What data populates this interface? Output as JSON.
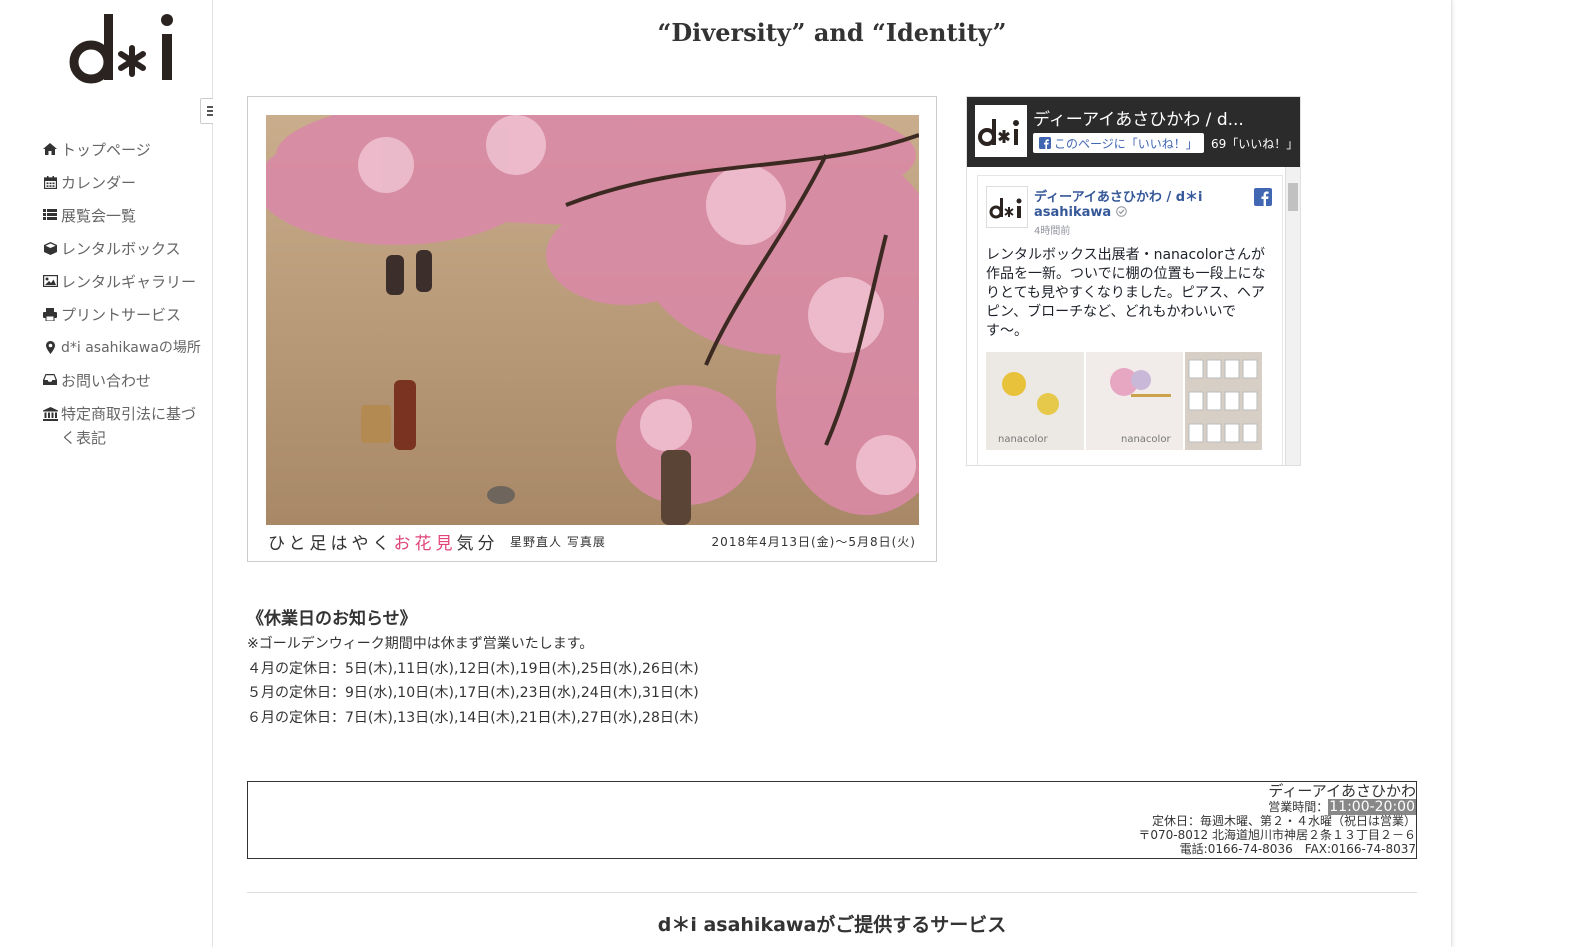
{
  "brand": {
    "logo_text": "d*i"
  },
  "nav": {
    "toggle_icon": "hamburger-icon",
    "items": [
      {
        "label": "トップページ",
        "icon": "home-icon"
      },
      {
        "label": "カレンダー",
        "icon": "calendar-icon"
      },
      {
        "label": "展覧会一覧",
        "icon": "list-icon"
      },
      {
        "label": "レンタルボックス",
        "icon": "cube-icon"
      },
      {
        "label": "レンタルギャラリー",
        "icon": "picture-icon"
      },
      {
        "label": "プリントサービス",
        "icon": "print-icon"
      },
      {
        "label": "d*i asahikawaの場所",
        "icon": "map-marker-icon"
      },
      {
        "label": "お問い合わせ",
        "icon": "inbox-icon"
      },
      {
        "label": "特定商取引法に基づく表記",
        "icon": "bank-icon"
      }
    ]
  },
  "main": {
    "tagline": "“Diversity” and “Identity”",
    "banner": {
      "caption_before": "ひと足はやく",
      "caption_highlight": "お花見",
      "caption_after": "気分",
      "photographer": "星野直人 写真展",
      "dates": "2018年4月13日(金)〜5月8日(火)"
    },
    "facebook": {
      "page_title": "ディーアイあさひかわ / d...",
      "like_button": "このページに「いいね！」",
      "like_count": "69「いいね！」",
      "post_name_line1": "ディーアイあさひかわ / d＊i",
      "post_name_line2": "asahikawa",
      "post_time": "4時間前",
      "post_text": "レンタルボックス出展者・nanacolorさんが作品を一新。ついでに棚の位置も一段上になりとても見やすくなりました。ピアス、ヘアピン、ブローチなど、どれもかわいいです〜。",
      "img_label": "nanacolor"
    },
    "notice": {
      "title": "《休業日のお知らせ》",
      "lines": [
        "※ゴールデンウィーク期間中は休まず営業いたします。",
        "４月の定休日：5日(木),11日(水),12日(木),19日(木),25日(水),26日(木)",
        "５月の定休日：9日(水),10日(木),17日(木),23日(水),24日(木),31日(木)",
        "６月の定休日：7日(木),13日(水),14日(木),21日(木),27日(水),28日(木)"
      ]
    },
    "info": {
      "name": "ディーアイあさひかわ",
      "hours_label": "営業時間：",
      "hours_value": "11:00-20:00",
      "closed": "定休日：毎週木曜、第２・４水曜（祝日は営業）",
      "address": "〒070-8012 北海道旭川市神居２条１３丁目２－６",
      "phone": "電話:0166-74-8036　FAX:0166-74-8037"
    },
    "services_title": "d＊i asahikawaがご提供するサービス"
  },
  "colors": {
    "accent_pink": "#e0457a",
    "fb_blue": "#4267b2",
    "text": "#333333"
  }
}
